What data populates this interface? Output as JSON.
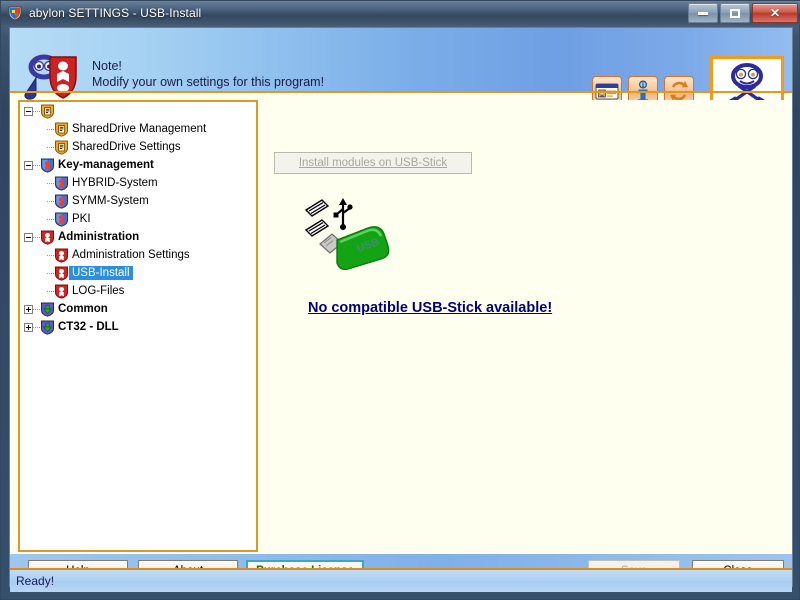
{
  "window": {
    "title": "abylon SETTINGS - USB-Install",
    "icon": "shield-app-icon",
    "controls": {
      "minimize": "minimize-button",
      "maximize": "restore-button",
      "close": "close-button",
      "close_glyph": "✕"
    }
  },
  "header": {
    "note_label": "Note!",
    "note_text": "Modify your own settings for this program!",
    "mascot_icon": "abylon-mascot-icon",
    "logo_icon": "abylon-figure-logo",
    "icons": [
      {
        "name": "id-card-icon"
      },
      {
        "name": "info-icon"
      },
      {
        "name": "refresh-icon"
      }
    ]
  },
  "tree": {
    "items": [
      {
        "label": "",
        "depth": 0,
        "state": "expanded",
        "icon": "shared-drive-shield-icon",
        "bold": false,
        "selected": false,
        "hidden_label": true
      },
      {
        "label": "SharedDrive Management",
        "depth": 1,
        "state": "leaf",
        "icon": "shared-drive-shield-icon",
        "bold": false,
        "selected": false
      },
      {
        "label": "SharedDrive Settings",
        "depth": 1,
        "state": "leaf",
        "icon": "shared-drive-shield-icon",
        "bold": false,
        "selected": false
      },
      {
        "label": "Key-management",
        "depth": 0,
        "state": "expanded",
        "icon": "key-management-shield-icon",
        "bold": true,
        "selected": false
      },
      {
        "label": "HYBRID-System",
        "depth": 1,
        "state": "leaf",
        "icon": "key-management-shield-icon",
        "bold": false,
        "selected": false
      },
      {
        "label": "SYMM-System",
        "depth": 1,
        "state": "leaf",
        "icon": "key-management-shield-icon",
        "bold": false,
        "selected": false
      },
      {
        "label": "PKI",
        "depth": 1,
        "state": "leaf",
        "icon": "key-management-shield-icon",
        "bold": false,
        "selected": false
      },
      {
        "label": "Administration",
        "depth": 0,
        "state": "expanded",
        "icon": "administration-shield-icon",
        "bold": true,
        "selected": false
      },
      {
        "label": "Administration Settings",
        "depth": 1,
        "state": "leaf",
        "icon": "administration-shield-icon",
        "bold": false,
        "selected": false
      },
      {
        "label": "USB-Install",
        "depth": 1,
        "state": "leaf",
        "icon": "administration-shield-icon",
        "bold": false,
        "selected": true
      },
      {
        "label": "LOG-Files",
        "depth": 1,
        "state": "leaf",
        "icon": "administration-shield-icon",
        "bold": false,
        "selected": false
      },
      {
        "label": "Common",
        "depth": 0,
        "state": "collapsed",
        "icon": "common-shield-icon",
        "bold": true,
        "selected": false
      },
      {
        "label": "CT32 - DLL",
        "depth": 0,
        "state": "collapsed",
        "icon": "common-shield-icon",
        "bold": true,
        "selected": false
      }
    ]
  },
  "content": {
    "install_button_label": "Install modules on USB-Stick",
    "install_button_enabled": false,
    "usb_graphic": "usb-stick-icon",
    "usb_body_label": "USB",
    "message": "No compatible USB-Stick available!"
  },
  "buttons": {
    "help": {
      "prefix": "",
      "accel": "H",
      "suffix": "elp"
    },
    "about": {
      "prefix": "",
      "accel": "A",
      "suffix": "bout"
    },
    "purchase": {
      "prefix": "",
      "accel": "P",
      "suffix": "urchase License"
    },
    "save": {
      "prefix": "",
      "accel": "S",
      "suffix": "ave"
    },
    "close": {
      "prefix": "",
      "accel": "C",
      "suffix": "lose"
    }
  },
  "status": {
    "text": "Ready!"
  },
  "colors": {
    "accent_orange": "#e39a1c",
    "selection_blue": "#2a8fe0",
    "link_navy": "#00007f",
    "purchase_green": "#008000",
    "panel_ivory": "#fffff0"
  }
}
